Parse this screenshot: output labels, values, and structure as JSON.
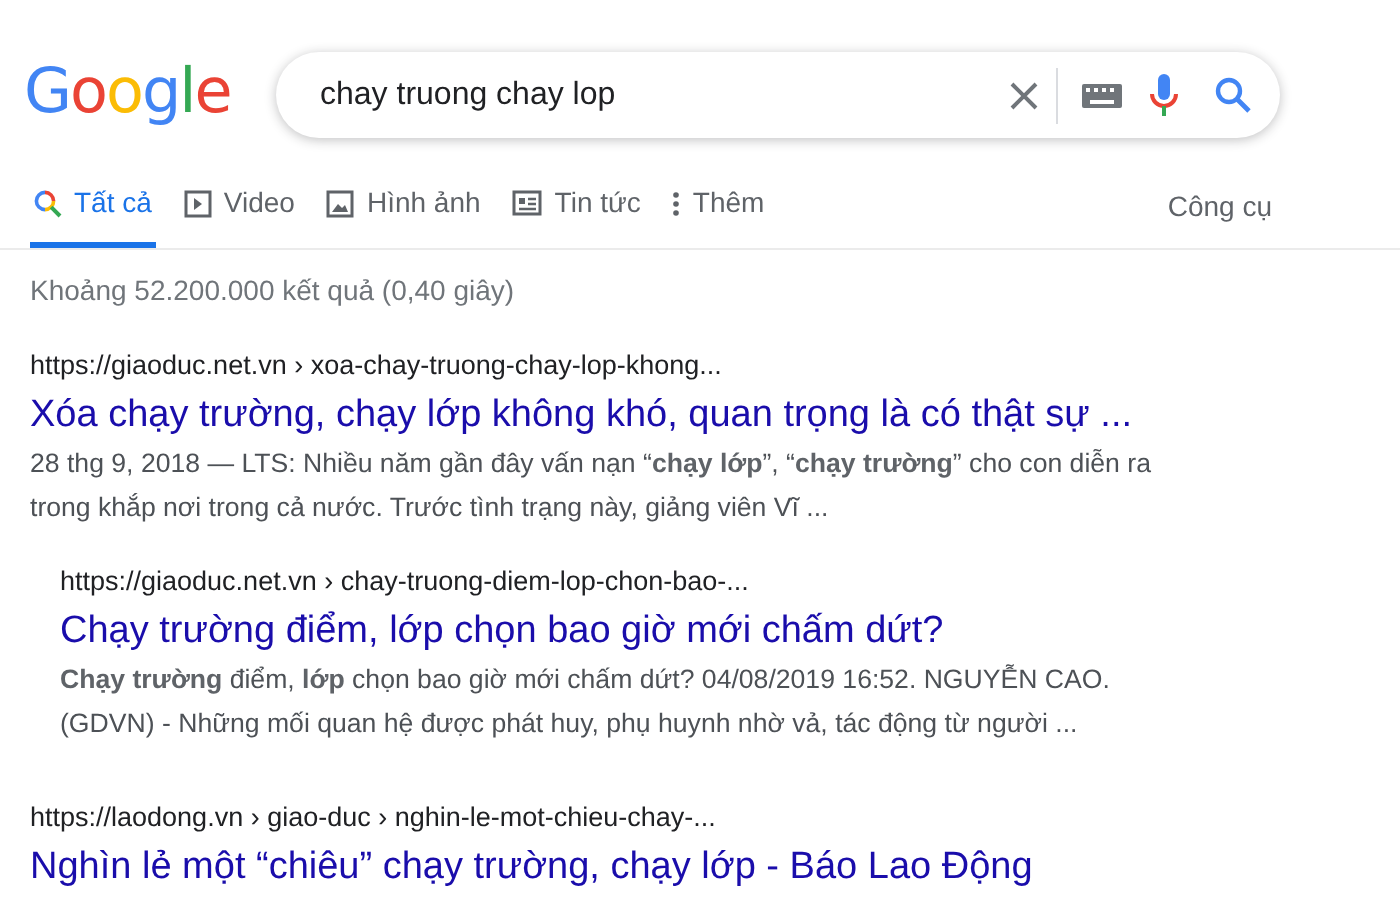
{
  "logo": "Google",
  "search": {
    "value": "chay truong chay lop"
  },
  "tabs": [
    {
      "label": "Tất cả",
      "kind": "all",
      "selected": true
    },
    {
      "label": "Video",
      "kind": "video",
      "selected": false
    },
    {
      "label": "Hình ảnh",
      "kind": "images",
      "selected": false
    },
    {
      "label": "Tin tức",
      "kind": "news",
      "selected": false
    },
    {
      "label": "Thêm",
      "kind": "more",
      "selected": false
    }
  ],
  "tools": "Công cụ",
  "stats": "Khoảng 52.200.000 kết quả (0,40 giây)",
  "results": [
    {
      "url": "https://giaoduc.net.vn › xoa-chay-truong-chay-lop-khong...",
      "title": "Xóa chạy trường, chạy lớp không khó, quan trọng là có thật sự ...",
      "snippet": "28 thg 9, 2018 — LTS: Nhiều năm gần đây vấn nạn “**chạy lớp**”, “**chạy trường**” cho con diễn ra trong khắp nơi trong cả nước. Trước tình trạng này, giảng viên Vĩ ...",
      "indented": false
    },
    {
      "url": "https://giaoduc.net.vn › chay-truong-diem-lop-chon-bao-...",
      "title": "Chạy trường điểm, lớp chọn bao giờ mới chấm dứt?",
      "snippet": "**Chạy trường** điểm, **lớp** chọn bao giờ mới chấm dứt? 04/08/2019 16:52. NGUYỄN CAO. (GDVN) - Những mối quan hệ được phát huy, phụ huynh nhờ vả, tác động từ người ...",
      "indented": true
    },
    {
      "url": "https://laodong.vn › giao-duc › nghin-le-mot-chieu-chay-...",
      "title": "Nghìn lẻ một “chiêu” chạy trường, chạy lớp - Báo Lao Động",
      "indented": false
    }
  ]
}
